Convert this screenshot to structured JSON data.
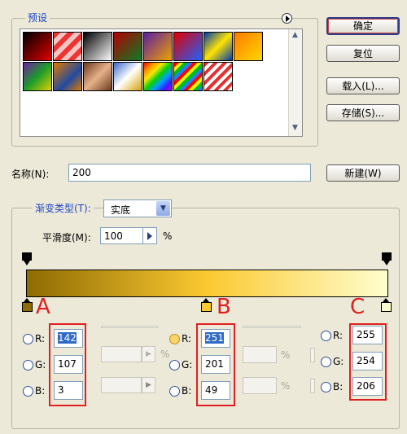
{
  "presets": {
    "title": "预设",
    "menu_icon": "circle-arrow-icon"
  },
  "buttons": {
    "ok": "确定",
    "reset": "复位",
    "load": "载入(L)...",
    "save": "存储(S)..."
  },
  "name": {
    "label": "名称(N):",
    "value": "200",
    "new_button": "新建(W)"
  },
  "gradient": {
    "type_label": "渐变类型(T):",
    "type_value": "实底",
    "smooth_label": "平滑度(M):",
    "smooth_value": "100",
    "smooth_unit": "%",
    "start_color": "#8e6b03",
    "mid_color": "#fbc931",
    "end_color": "#fffece"
  },
  "annotations": {
    "a": "A",
    "b": "B",
    "c": "C"
  },
  "color_a": {
    "r_label": "R:",
    "g_label": "G:",
    "b_label": "B:",
    "r": "142",
    "g": "107",
    "b": "3"
  },
  "color_b": {
    "r_label": "R:",
    "g_label": "G:",
    "b_label": "B:",
    "r": "251",
    "g": "201",
    "b": "49"
  },
  "color_c": {
    "r_label": "R:",
    "g_label": "G:",
    "b_label": "B:",
    "r": "255",
    "g": "254",
    "b": "206"
  },
  "pct": "%",
  "swatches": [
    "linear-gradient(135deg,#000 0%,#e00000 100%)",
    "repeating-linear-gradient(135deg,#e33 0 6px,#f7c4c4 6px 12px)",
    "linear-gradient(135deg,#000 0%,#fff 100%)",
    "linear-gradient(135deg,#b10000 0%,#0b7d26 100%)",
    "linear-gradient(135deg,#5b1fa0 0%,#f0a000 100%)",
    "linear-gradient(135deg,#e00000 0%,#2060ff 100%)",
    "linear-gradient(135deg,#003ab0 0%,#ffe400 50%,#003ab0 100%)",
    "linear-gradient(135deg,#ff7a00 0%,#ffd800 100%)",
    "linear-gradient(135deg,#6a1fa0 0%,#1d9d29 50%,#e3d000 100%)",
    "linear-gradient(135deg,#e07a00 0%,#224aa0 60%,#e07a00 100%)",
    "linear-gradient(135deg,#6b3a1d 0%,#e6b08a 50%,#6b3a1d 100%)",
    "linear-gradient(135deg,#3b69c8 0%,#fff 50%,#d7a000 100%)",
    "linear-gradient(135deg,#ff0000,#ff8a00,#ffe600,#0ad000,#00a0ff,#3a1cff,#c000ff)",
    "repeating-linear-gradient(135deg,#ff0000 0 4px,#ffee00 4px 8px,#00c000 8px 12px,#2080ff 12px 16px)",
    "repeating-linear-gradient(135deg,#e53030 0 4px,#fff 4px 8px)"
  ]
}
